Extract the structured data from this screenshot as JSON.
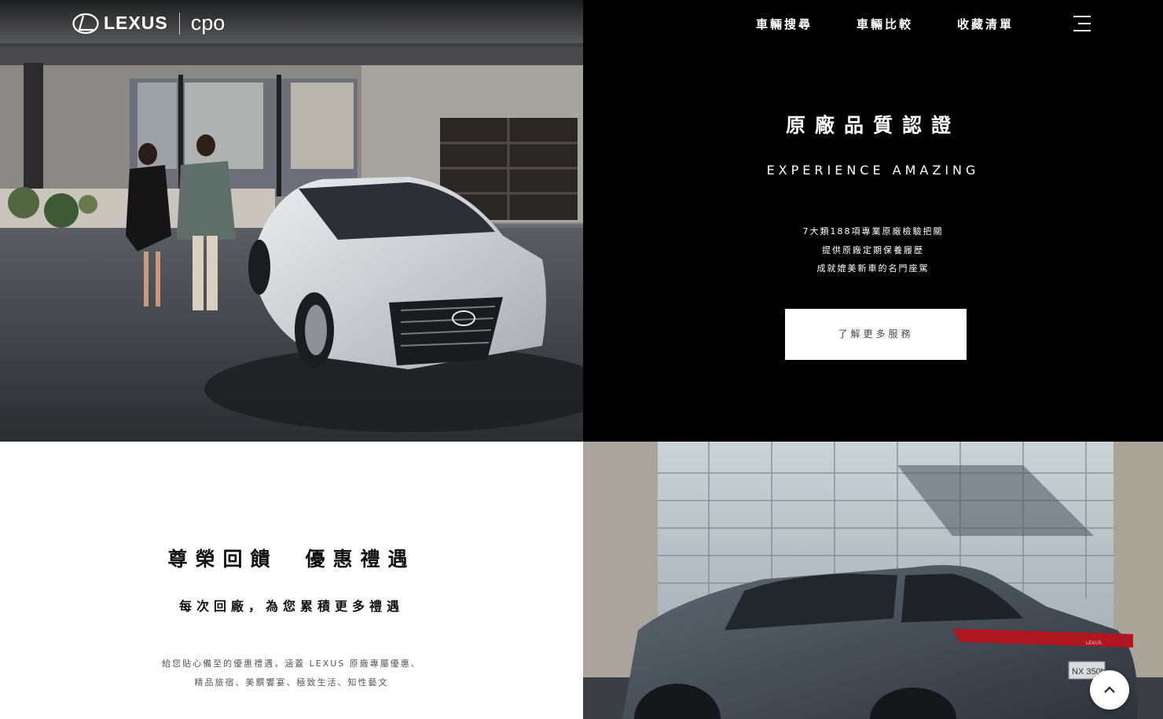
{
  "header": {
    "brand": "LEXUS",
    "sub_brand": "cpo",
    "nav": [
      {
        "label": "車輛搜尋"
      },
      {
        "label": "車輛比較"
      },
      {
        "label": "收藏清單"
      }
    ],
    "menu_icon": "hamburger-menu-icon"
  },
  "quality": {
    "title": "原廠品質認證",
    "subtitle": "EXPERIENCE AMAZING",
    "lines": [
      "7大類188項專業原廠檢驗把關",
      "提供原廠定期保養履歷",
      "成就媲美新車的名門座駕"
    ],
    "button_label": "了解更多服務"
  },
  "rewards": {
    "title": "尊榮回饋　優惠禮遇",
    "subtitle": "每次回廠，為您累積更多禮遇",
    "lines": [
      "給您貼心備至的優惠禮遇，涵蓋 LEXUS 原廠專屬優惠、",
      "精品旅宿、美饌饗宴、極致生活、知性藝文"
    ]
  },
  "images": {
    "sedan": {
      "plate": ""
    },
    "suv": {
      "badge": "NX 350h",
      "rear_text": "LEXUS"
    }
  },
  "scroll_top_icon": "chevron-up-icon",
  "colors": {
    "accent": "#000000",
    "text_light": "#ffffff",
    "button_bg": "#ffffff",
    "tail_light": "#b01620"
  }
}
